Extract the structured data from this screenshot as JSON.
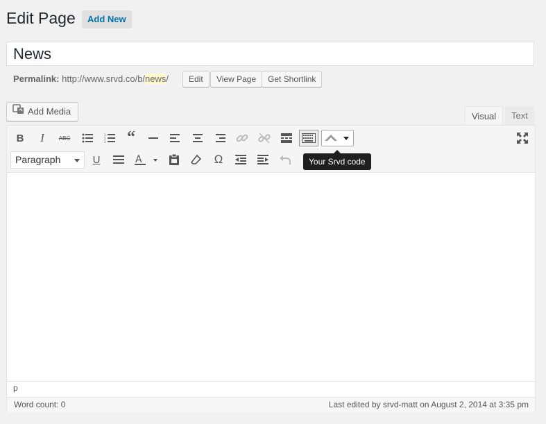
{
  "header": {
    "title": "Edit Page",
    "add_new_label": "Add New"
  },
  "post": {
    "title_value": "News"
  },
  "permalink": {
    "label": "Permalink:",
    "base_url": "http://www.srvd.co/b/",
    "slug": "news",
    "trailing": "/",
    "buttons": {
      "edit": "Edit",
      "view_page": "View Page",
      "get_shortlink": "Get Shortlink"
    }
  },
  "media": {
    "add_media_label": "Add Media",
    "icon": "media-icon"
  },
  "tabs": {
    "visual": "Visual",
    "text": "Text",
    "active": "visual"
  },
  "toolbar": {
    "row1_icons": [
      "bold-icon",
      "italic-icon",
      "strikethrough-icon",
      "bullet-list-icon",
      "numbered-list-icon",
      "blockquote-icon",
      "horizontal-rule-icon",
      "align-left-icon",
      "align-center-icon",
      "align-right-icon",
      "link-icon",
      "unlink-icon",
      "read-more-icon",
      "toolbar-toggle-icon",
      "srvd-dropdown-icon",
      "fullscreen-icon"
    ],
    "row2_icons": [
      "underline-icon",
      "justify-icon",
      "text-color-icon",
      "paste-text-icon",
      "clear-formatting-icon",
      "special-character-icon",
      "outdent-icon",
      "indent-icon",
      "undo-icon"
    ],
    "format_select": "Paragraph",
    "tooltip": "Your Srvd code"
  },
  "editor": {
    "path": "p"
  },
  "status": {
    "word_count": "Word count: 0",
    "last_edited": "Last edited by srvd-matt on August 2, 2014 at 3:35 pm"
  },
  "colors": {
    "accent": "#0073aa",
    "background": "#f1f1f1",
    "slug_highlight": "#fffbcc",
    "tooltip_bg": "#1f1f1f"
  }
}
